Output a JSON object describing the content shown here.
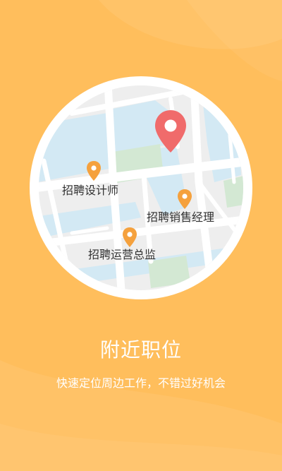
{
  "map": {
    "pins": [
      {
        "label": "招聘设计师"
      },
      {
        "label": "招聘销售经理"
      },
      {
        "label": "招聘运营总监"
      }
    ]
  },
  "title": "附近职位",
  "subtitle": "快速定位周边工作，不错过好机会",
  "colors": {
    "background": "#ffbe5c",
    "main_pin": "#f06b6b",
    "job_pin": "#f5a13d",
    "water": "#d3e9f4",
    "park": "#d3e8d3"
  },
  "icons": [
    "location-pin-icon"
  ]
}
